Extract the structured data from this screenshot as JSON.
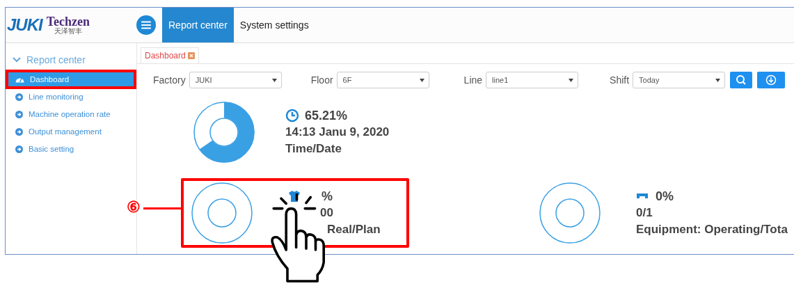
{
  "header": {
    "logo": "JUKI",
    "brand": "Techzen",
    "brand_sub": "天泽智丰",
    "tabs": [
      {
        "label": "Report center",
        "selected": true
      },
      {
        "label": "System settings",
        "selected": false
      }
    ]
  },
  "sidebar": {
    "title": "Report center",
    "items": [
      {
        "label": "Dashboard",
        "selected": true,
        "highlighted": true,
        "kind": "dashboard"
      },
      {
        "label": "Line monitoring",
        "selected": false,
        "highlighted": false,
        "kind": "link"
      },
      {
        "label": "Machine operation rate",
        "selected": false,
        "highlighted": false,
        "kind": "link"
      },
      {
        "label": "Output management",
        "selected": false,
        "highlighted": false,
        "kind": "link"
      },
      {
        "label": "Basic setting",
        "selected": false,
        "highlighted": false,
        "kind": "link"
      }
    ]
  },
  "page_tabs": [
    {
      "label": "Dashboard",
      "selected": true
    }
  ],
  "filters": [
    {
      "label": "Factory",
      "value": "JUKI"
    },
    {
      "label": "Floor",
      "value": "6F"
    },
    {
      "label": "Line",
      "value": "line1"
    },
    {
      "label": "Shift",
      "value": "Today"
    }
  ],
  "stats": [
    {
      "kind": "clock",
      "highlighted": false,
      "lines": [
        "65.21%",
        "14:13 Janu 9, 2020",
        "Time/Date"
      ]
    },
    {
      "kind": "shirt",
      "highlighted": true,
      "marker": "⑥",
      "lines": [
        "%",
        "00",
        "Real/Plan"
      ]
    },
    {
      "kind": "machine",
      "highlighted": false,
      "lines": [
        "0%",
        "0/1",
        "Equipment: Operating/Tota"
      ]
    }
  ]
}
